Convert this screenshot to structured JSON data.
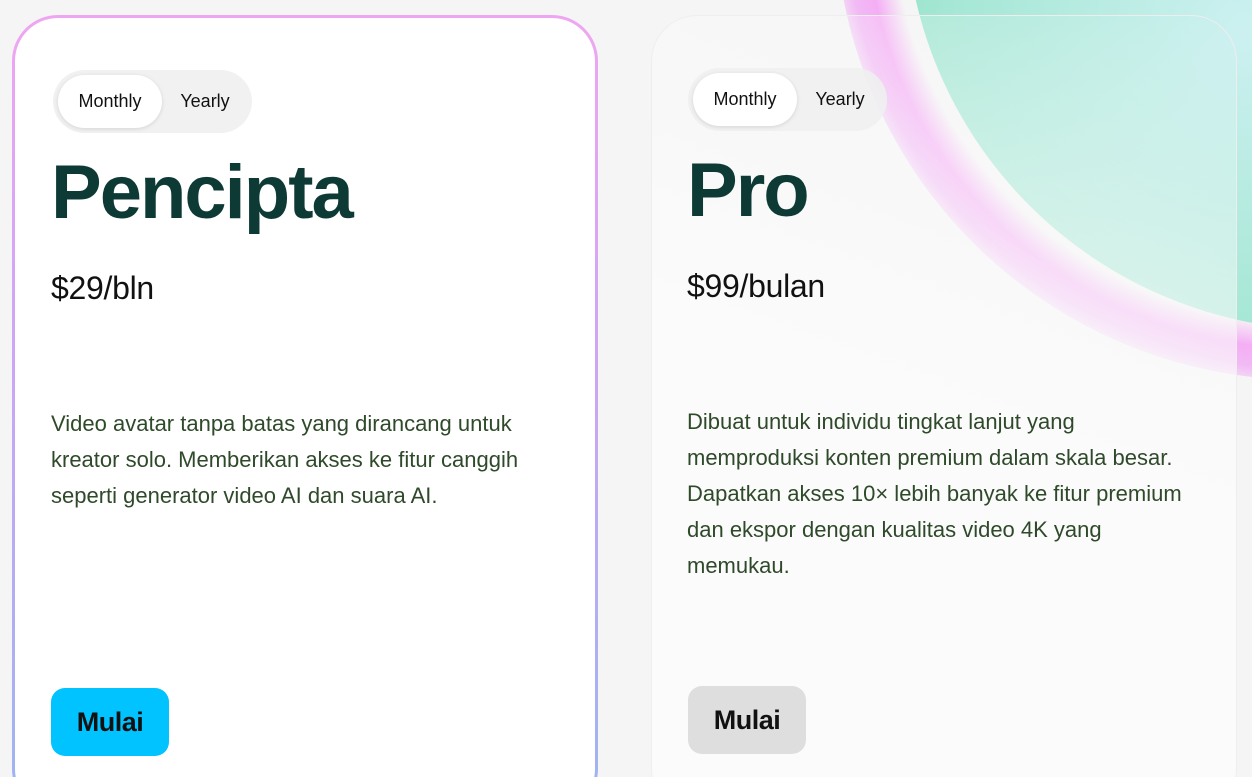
{
  "colors": {
    "creator_button_bg": "#00c3ff",
    "pro_button_bg": "#dedede",
    "title_color": "#0e3a36",
    "description_color": "#2f4a2a",
    "creator_border_gradient": [
      "#efa6f2",
      "#cba6f5",
      "#9cb5f2"
    ]
  },
  "plans": [
    {
      "billing_toggle": {
        "options": [
          "Monthly",
          "Yearly"
        ],
        "selected": "Monthly"
      },
      "name": "Pencipta",
      "price": "$29/bln",
      "description": "Video avatar tanpa batas yang dirancang untuk kreator solo. Memberikan akses ke fitur canggih seperti generator video AI dan suara AI.",
      "cta_label": "Mulai"
    },
    {
      "billing_toggle": {
        "options": [
          "Monthly",
          "Yearly"
        ],
        "selected": "Monthly"
      },
      "name": "Pro",
      "price": "$99/bulan",
      "description": "Dibuat untuk individu tingkat lanjut yang memproduksi konten premium dalam skala besar. Dapatkan akses 10× lebih banyak ke fitur premium dan ekspor dengan kualitas video 4K yang memukau.",
      "cta_label": "Mulai"
    }
  ]
}
